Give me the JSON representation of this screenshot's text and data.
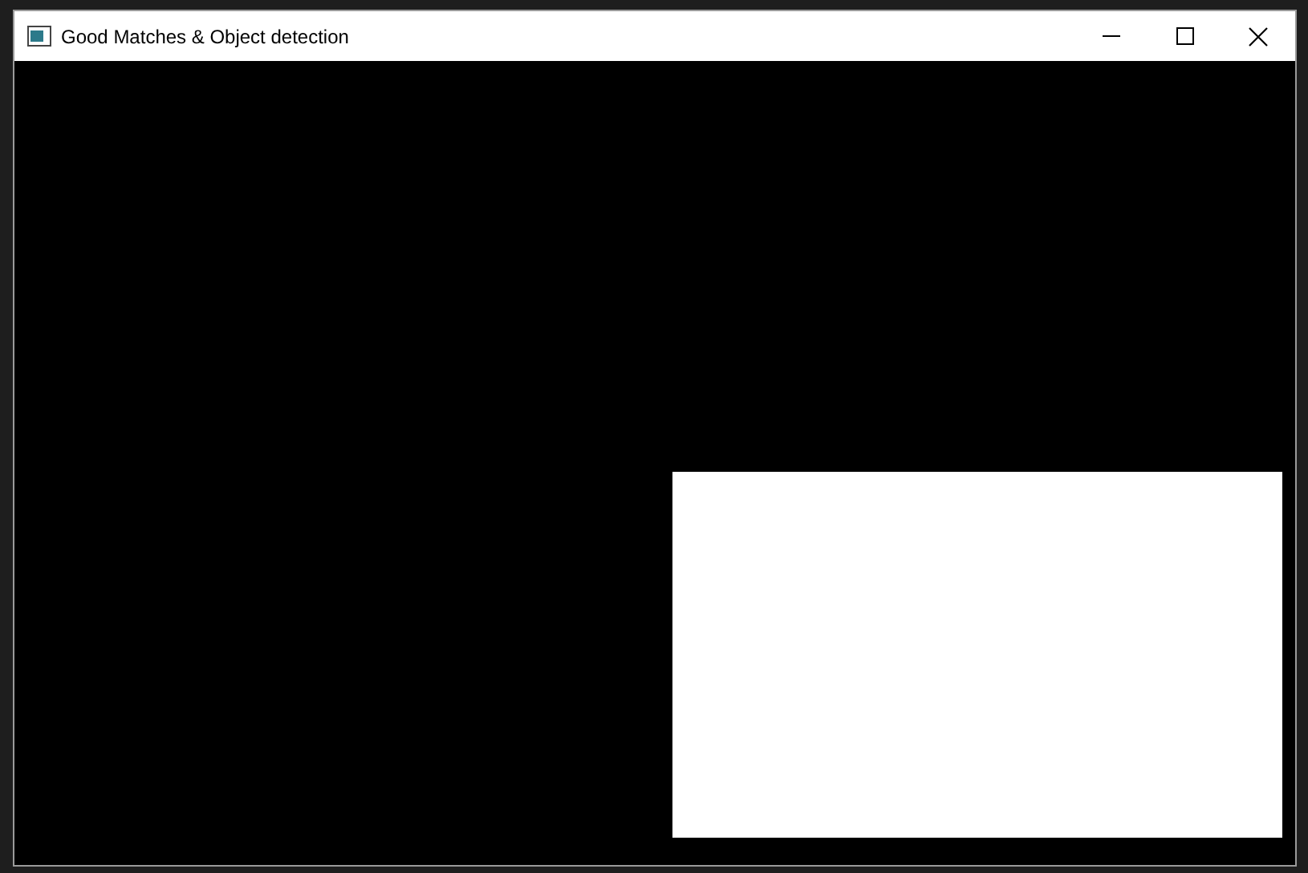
{
  "window": {
    "title": "Good Matches & Object detection"
  }
}
